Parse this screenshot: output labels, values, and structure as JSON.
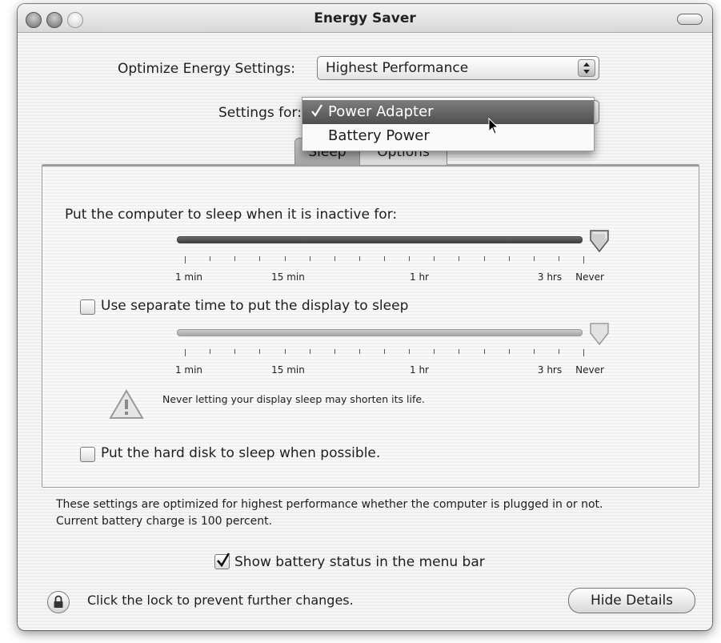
{
  "window": {
    "title": "Energy Saver"
  },
  "optimize": {
    "label": "Optimize Energy Settings:",
    "value": "Highest Performance"
  },
  "settings_for": {
    "label": "Settings for:",
    "menu_items": [
      {
        "label": "Power Adapter",
        "checked": true,
        "highlighted": true
      },
      {
        "label": "Battery Power",
        "checked": false,
        "highlighted": false
      }
    ]
  },
  "tabs": [
    {
      "label": "Sleep",
      "active": true
    },
    {
      "label": "Options",
      "active": false
    }
  ],
  "sleep": {
    "computer_label": "Put the computer to sleep when it is inactive for:",
    "computer_slider_value": "Never",
    "tick_labels": [
      "1 min",
      "15 min",
      "1 hr",
      "3 hrs",
      "Never"
    ],
    "display_checkbox_label": "Use separate time to put the display to sleep",
    "display_checkbox_checked": false,
    "display_slider_value": "Never",
    "warning_text": "Never letting your display sleep may shorten its life.",
    "harddisk_checkbox_label": "Put the hard disk to sleep when possible.",
    "harddisk_checkbox_checked": false
  },
  "info": {
    "line1": "These settings are optimized for highest performance whether the computer is plugged in or not.",
    "line2": "Current battery charge is 100 percent."
  },
  "battery_status": {
    "label": "Show battery status in the menu bar",
    "checked": true
  },
  "footer": {
    "lock_text": "Click the lock to prevent further changes.",
    "hide_details_label": "Hide Details"
  },
  "icons": {
    "lock": "lock-icon",
    "warning": "warning-icon",
    "check": "checkmark-icon",
    "cursor": "mouse-cursor-icon"
  }
}
